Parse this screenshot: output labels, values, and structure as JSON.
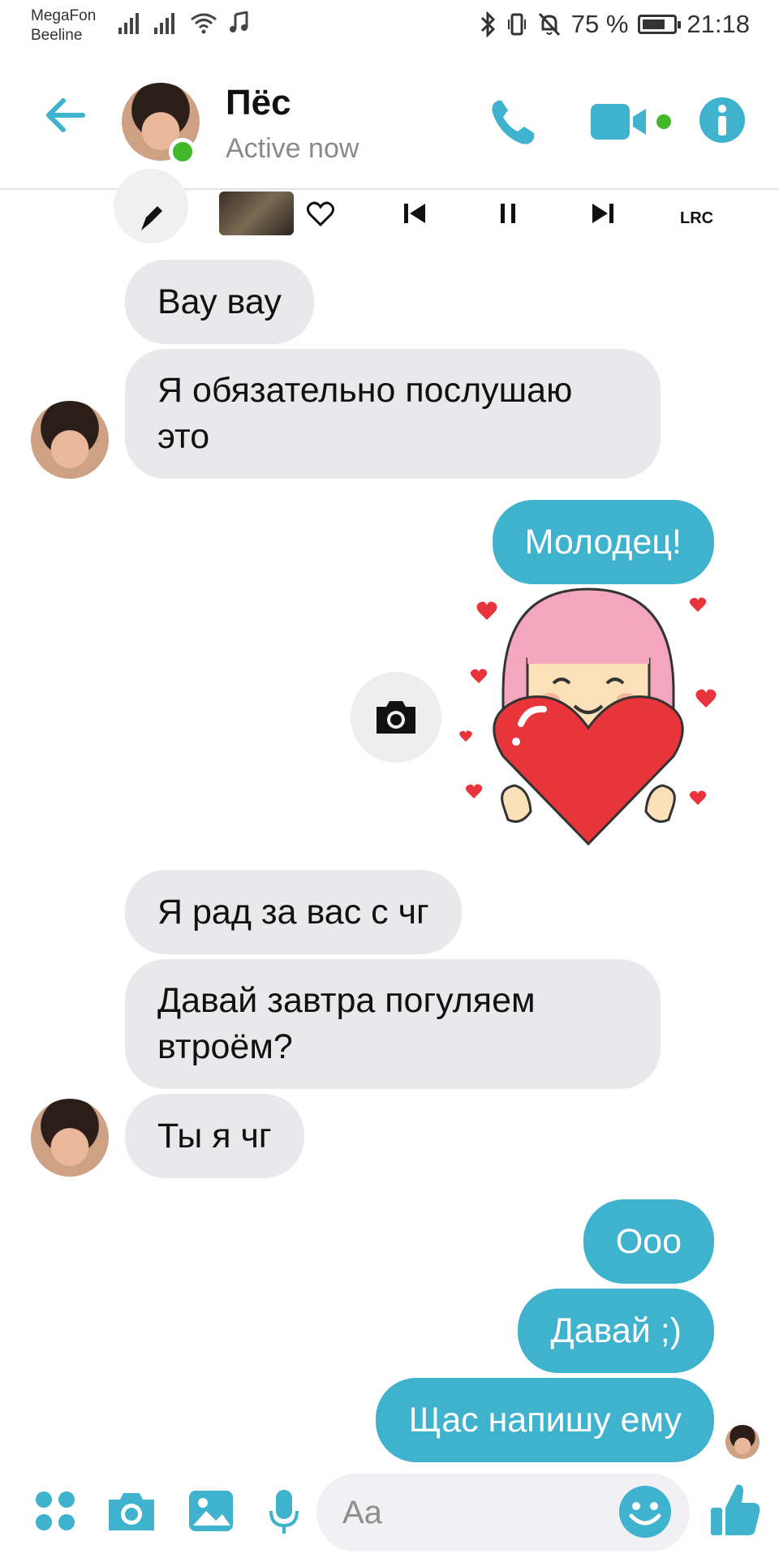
{
  "statusbar": {
    "carrier1": "MegaFon",
    "carrier2": "Beeline",
    "battery_text": "75 %",
    "battery_level": 0.75,
    "time": "21:18"
  },
  "header": {
    "title": "Пёс",
    "subtitle": "Active now",
    "accent": "#3fb2cd",
    "online_color": "#42b72a"
  },
  "music": {
    "lrc_label": "LRC"
  },
  "messages": [
    {
      "side": "in",
      "text": "Вау вау"
    },
    {
      "side": "in",
      "text": "Я обязательно послушаю это"
    },
    {
      "side": "out",
      "text": "Молодец!"
    },
    {
      "side": "out",
      "type": "sticker",
      "icon": "girl-holding-heart-sticker"
    },
    {
      "side": "in",
      "text": "Я рад за вас с чг"
    },
    {
      "side": "in",
      "text": "Давай завтра погуляем втроём?"
    },
    {
      "side": "in",
      "text": "Ты я чг"
    },
    {
      "side": "out",
      "text": "Ооо"
    },
    {
      "side": "out",
      "text": "Давай ;)"
    },
    {
      "side": "out",
      "text": "Щас напишу ему"
    }
  ],
  "composer": {
    "placeholder": "Aa"
  },
  "colors": {
    "incoming_bubble": "#e9e9eb",
    "outgoing_bubble": "#3fb2cd"
  }
}
